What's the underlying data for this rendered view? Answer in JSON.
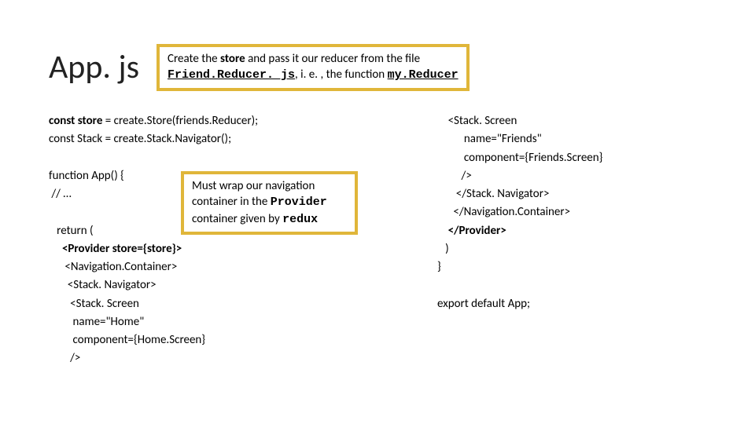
{
  "title": "App. js",
  "callout_top": {
    "t1": "Create the ",
    "t2": "store",
    "t3": " and pass it our reducer from the file ",
    "t4": "Friend.Reducer. js",
    "t5": ", i. e. , the function ",
    "t6": "my.Reducer"
  },
  "left_code": {
    "l1a": "const store",
    "l1b": " = create.Store(friends.Reducer);",
    "l2": "const Stack = create.Stack.Navigator();",
    "l3": "",
    "l4": "function App() {",
    "l5": " // …",
    "l6": "",
    "l7": "   return (",
    "l8a": "     <Provider ",
    "l8b": "store",
    "l8c": "={store}>",
    "l9": "      <Navigation.Container>",
    "l10": "       <Stack. Navigator>",
    "l11": "        <Stack. Screen",
    "l12": "         name=\"Home\"",
    "l13": "         component={Home.Screen}",
    "l14": "        />"
  },
  "right_code": {
    "r1": "    <Stack. Screen",
    "r2": "          name=\"Friends\"",
    "r3": "          component={Friends.Screen}",
    "r4": "         />",
    "r5": "       </Stack. Navigator>",
    "r6": "      </Navigation.Container>",
    "r7a": "    </Provider>",
    "r8": "   )",
    "r9": "}",
    "r10": "",
    "r11": "export default App;"
  },
  "callout_mid": {
    "m1": "Must wrap our navigation container in the ",
    "m2": "Provider",
    "m3": " container given by ",
    "m4": "redux"
  }
}
